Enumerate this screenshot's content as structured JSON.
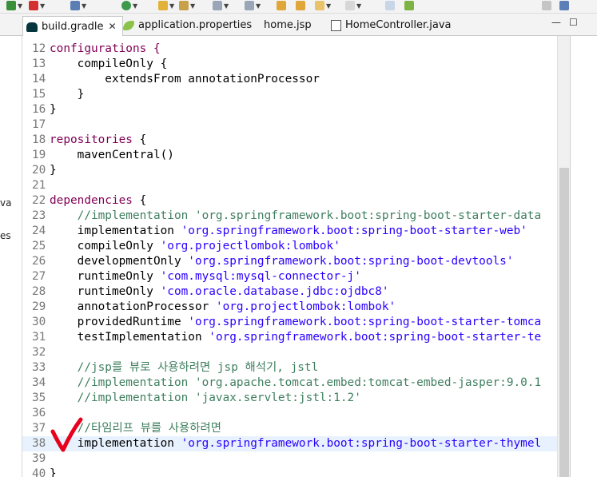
{
  "tabs": [
    {
      "label": "build.gradle",
      "icon": "gradle-elephant-icon",
      "active": true,
      "close": "✕"
    },
    {
      "label": "application.properties",
      "icon": "spring-leaf-icon",
      "active": false
    },
    {
      "label": "home.jsp",
      "icon": "",
      "active": false
    },
    {
      "label": "HomeController.java",
      "icon": "java-file-icon",
      "active": false
    }
  ],
  "window_controls": {
    "minimize": "—",
    "maximize": "☐"
  },
  "left_panel_fragments": [
    "va",
    "es"
  ],
  "editor": {
    "highlighted_line": "38",
    "lines": [
      {
        "n": "12",
        "parts": [
          {
            "t": "configurations {",
            "c": "kw"
          }
        ]
      },
      {
        "n": "13",
        "parts": [
          {
            "t": "    compileOnly {",
            "c": ""
          }
        ]
      },
      {
        "n": "14",
        "parts": [
          {
            "t": "        extendsFrom annotationProcessor",
            "c": ""
          }
        ]
      },
      {
        "n": "15",
        "parts": [
          {
            "t": "    }",
            "c": ""
          }
        ]
      },
      {
        "n": "16",
        "parts": [
          {
            "t": "}",
            "c": ""
          }
        ]
      },
      {
        "n": "17",
        "parts": []
      },
      {
        "n": "18",
        "parts": [
          {
            "t": "repositories",
            "c": "kw"
          },
          {
            "t": " {",
            "c": ""
          }
        ]
      },
      {
        "n": "19",
        "parts": [
          {
            "t": "    mavenCentral()",
            "c": ""
          }
        ]
      },
      {
        "n": "20",
        "parts": [
          {
            "t": "}",
            "c": ""
          }
        ]
      },
      {
        "n": "21",
        "parts": []
      },
      {
        "n": "22",
        "parts": [
          {
            "t": "dependencies",
            "c": "kw"
          },
          {
            "t": " {",
            "c": ""
          }
        ]
      },
      {
        "n": "23",
        "parts": [
          {
            "t": "    //implementation 'org.springframework.boot:spring-boot-starter-data",
            "c": "cm"
          }
        ]
      },
      {
        "n": "24",
        "parts": [
          {
            "t": "    implementation ",
            "c": ""
          },
          {
            "t": "'org.springframework.boot:spring-boot-starter-web'",
            "c": "str"
          }
        ]
      },
      {
        "n": "25",
        "parts": [
          {
            "t": "    compileOnly ",
            "c": ""
          },
          {
            "t": "'org.projectlombok:lombok'",
            "c": "str"
          }
        ]
      },
      {
        "n": "26",
        "parts": [
          {
            "t": "    developmentOnly ",
            "c": ""
          },
          {
            "t": "'org.springframework.boot:spring-boot-devtools'",
            "c": "str"
          }
        ]
      },
      {
        "n": "27",
        "parts": [
          {
            "t": "    runtimeOnly ",
            "c": ""
          },
          {
            "t": "'com.mysql:mysql-connector-j'",
            "c": "str"
          }
        ]
      },
      {
        "n": "28",
        "parts": [
          {
            "t": "    runtimeOnly ",
            "c": ""
          },
          {
            "t": "'com.oracle.database.jdbc:ojdbc8'",
            "c": "str"
          }
        ]
      },
      {
        "n": "29",
        "parts": [
          {
            "t": "    annotationProcessor ",
            "c": ""
          },
          {
            "t": "'org.projectlombok:lombok'",
            "c": "str"
          }
        ]
      },
      {
        "n": "30",
        "parts": [
          {
            "t": "    providedRuntime ",
            "c": ""
          },
          {
            "t": "'org.springframework.boot:spring-boot-starter-tomca",
            "c": "str"
          }
        ]
      },
      {
        "n": "31",
        "parts": [
          {
            "t": "    testImplementation ",
            "c": ""
          },
          {
            "t": "'org.springframework.boot:spring-boot-starter-te",
            "c": "str"
          }
        ]
      },
      {
        "n": "32",
        "parts": []
      },
      {
        "n": "33",
        "parts": [
          {
            "t": "    //jsp를 뷰로 사용하려면 jsp 해석기, jstl",
            "c": "cm"
          }
        ]
      },
      {
        "n": "34",
        "parts": [
          {
            "t": "    //implementation 'org.apache.tomcat.embed:tomcat-embed-jasper:9.0.1",
            "c": "cm"
          }
        ]
      },
      {
        "n": "35",
        "parts": [
          {
            "t": "    //implementation 'javax.servlet:jstl:1.2'",
            "c": "cm"
          }
        ]
      },
      {
        "n": "36",
        "parts": []
      },
      {
        "n": "37",
        "parts": [
          {
            "t": "    //타임리프 뷰를 사용하려면",
            "c": "cm"
          }
        ]
      },
      {
        "n": "38",
        "parts": [
          {
            "t": "    implementation ",
            "c": ""
          },
          {
            "t": "'org.springframework.boot:spring-boot-starter-thymel",
            "c": "str"
          }
        ]
      },
      {
        "n": "39",
        "parts": []
      },
      {
        "n": "40",
        "parts": [
          {
            "t": "}",
            "c": ""
          }
        ]
      }
    ]
  },
  "colors": {
    "keyword": "#7f0055",
    "string": "#2a00ff",
    "comment": "#3f7f5f",
    "current_line": "#e8f2fe",
    "annotation_check": "#e8001c"
  }
}
